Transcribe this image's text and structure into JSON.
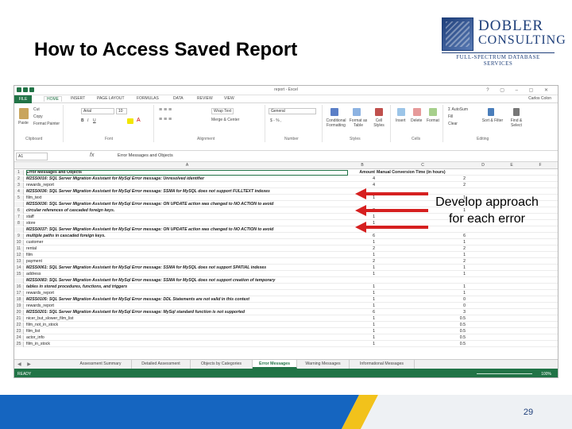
{
  "slide": {
    "title": "How to Access Saved Report",
    "callout_line1": "Develop approach",
    "callout_line2": "for each error",
    "page_number": "29"
  },
  "logo": {
    "line1": "DOBLER",
    "line2": "CONSULTING",
    "tagline": "FULL-SPECTRUM DATABASE SERVICES"
  },
  "excel": {
    "window_title": "report - Excel",
    "tabs": [
      "FILE",
      "HOME",
      "INSERT",
      "PAGE LAYOUT",
      "FORMULAS",
      "DATA",
      "REVIEW",
      "VIEW"
    ],
    "user": "Carlos Colon",
    "ribbon": {
      "clipboard": {
        "label": "Clipboard",
        "paste": "Paste",
        "cut": "Cut",
        "copy": "Copy",
        "format_painter": "Format Painter"
      },
      "font": {
        "label": "Font",
        "font_name": "Arial",
        "font_size": "10"
      },
      "alignment": {
        "label": "Alignment",
        "wrap": "Wrap Text",
        "merge": "Merge & Center"
      },
      "number": {
        "label": "Number",
        "format": "General"
      },
      "styles": {
        "label": "Styles",
        "cond": "Conditional Formatting",
        "table": "Format as Table",
        "cell": "Cell Styles"
      },
      "cells": {
        "label": "Cells",
        "insert": "Insert",
        "delete": "Delete",
        "format": "Format"
      },
      "editing": {
        "label": "Editing",
        "autosum": "AutoSum",
        "fill": "Fill",
        "clear": "Clear",
        "sort": "Sort & Filter",
        "find": "Find & Select"
      }
    },
    "name_box": "A1",
    "formula": "Error Messages and Objects",
    "columns": [
      "A",
      "B",
      "C",
      "D",
      "E",
      "F"
    ],
    "rows": [
      {
        "n": "1",
        "a": "Error Messages and Objects",
        "b": "Amount",
        "c": "Manual Conversion Time (in hours)",
        "type": "hdr"
      },
      {
        "n": "2",
        "a": "M2SS0016: SQL Server Migration Assistant for MySql Error message: Unresolved identifier",
        "b": "4",
        "c": "2",
        "type": "err"
      },
      {
        "n": "3",
        "a": "rewards_report",
        "b": "4",
        "c": "2",
        "type": "obj"
      },
      {
        "n": "4",
        "a": "M2SS0036: SQL Server Migration Assistant for MySql Error message: SSMA for MySQL does not support FULLTEXT indexes",
        "b": "",
        "c": "",
        "type": "err"
      },
      {
        "n": "5",
        "a": "film_text",
        "b": "1",
        "c": "1",
        "type": "obj"
      },
      {
        "n": "",
        "a": "M2SS0036: SQL Server Migration Assistant for MySql Error message: ON UPDATE action was changed to NO ACTION to avoid",
        "b": "",
        "c": "",
        "type": "err"
      },
      {
        "n": "6",
        "a": "circular references of cascaded foreign keys.",
        "b": "2",
        "c": "1",
        "type": "err"
      },
      {
        "n": "7",
        "a": "staff",
        "b": "1",
        "c": "",
        "type": "obj"
      },
      {
        "n": "8",
        "a": "store",
        "b": "1",
        "c": "",
        "type": "obj"
      },
      {
        "n": "",
        "a": "M2SS0037: SQL Server Migration Assistant for MySql Error message: ON UPDATE action was changed to NO ACTION to avoid",
        "b": "",
        "c": "",
        "type": "err"
      },
      {
        "n": "9",
        "a": "multiple paths in cascaded foreign keys.",
        "b": "6",
        "c": "6",
        "type": "err"
      },
      {
        "n": "10",
        "a": "customer",
        "b": "1",
        "c": "1",
        "type": "obj"
      },
      {
        "n": "11",
        "a": "rental",
        "b": "2",
        "c": "2",
        "type": "obj"
      },
      {
        "n": "12",
        "a": "film",
        "b": "1",
        "c": "1",
        "type": "obj"
      },
      {
        "n": "13",
        "a": "payment",
        "b": "2",
        "c": "2",
        "type": "obj"
      },
      {
        "n": "14",
        "a": "M2SS0061: SQL Server Migration Assistant for MySql Error message: SSMA for MySQL does not support SPATIAL indexes",
        "b": "1",
        "c": "1",
        "type": "err"
      },
      {
        "n": "15",
        "a": "address",
        "b": "1",
        "c": "1",
        "type": "obj"
      },
      {
        "n": "",
        "a": "M2SS0083: SQL Server Migration Assistant for MySql Error message: SSMA for MySQL does not support creation of temporary",
        "b": "",
        "c": "",
        "type": "err"
      },
      {
        "n": "16",
        "a": "tables in stored procedures, functions, and triggers",
        "b": "1",
        "c": "1",
        "type": "err"
      },
      {
        "n": "17",
        "a": "rewards_report",
        "b": "1",
        "c": "1",
        "type": "obj"
      },
      {
        "n": "18",
        "a": "M2SS0105: SQL Server Migration Assistant for MySql Error message: DDL Statements are not valid in this context",
        "b": "1",
        "c": "0",
        "type": "err"
      },
      {
        "n": "19",
        "a": "rewards_report",
        "b": "1",
        "c": "0",
        "type": "obj"
      },
      {
        "n": "20",
        "a": "M2SS0201: SQL Server Migration Assistant for MySql Error message: MySql standard function is not supported",
        "b": "6",
        "c": "3",
        "type": "err"
      },
      {
        "n": "21",
        "a": "nicer_but_slower_film_list",
        "b": "1",
        "c": "0.5",
        "type": "obj"
      },
      {
        "n": "22",
        "a": "film_not_in_stock",
        "b": "1",
        "c": "0.5",
        "type": "obj"
      },
      {
        "n": "23",
        "a": "film_list",
        "b": "1",
        "c": "0.5",
        "type": "obj"
      },
      {
        "n": "24",
        "a": "actor_info",
        "b": "1",
        "c": "0.5",
        "type": "obj"
      },
      {
        "n": "25",
        "a": "film_in_stock",
        "b": "1",
        "c": "0.5",
        "type": "obj"
      }
    ],
    "sheet_tabs": [
      {
        "label": "Assessment Summary",
        "active": false
      },
      {
        "label": "Detailed Assessment",
        "active": false
      },
      {
        "label": "Objects by Categories",
        "active": false
      },
      {
        "label": "Error Messages",
        "active": true
      },
      {
        "label": "Warning Messages",
        "active": false
      },
      {
        "label": "Informational Messages",
        "active": false
      }
    ],
    "status": "READY",
    "zoom": "100%"
  },
  "colors": {
    "excel_green": "#217346",
    "arrow_red": "#d62020",
    "brand_blue": "#1e3f7a",
    "footer_blue": "#1565c0",
    "footer_gold": "#f2c21b"
  }
}
